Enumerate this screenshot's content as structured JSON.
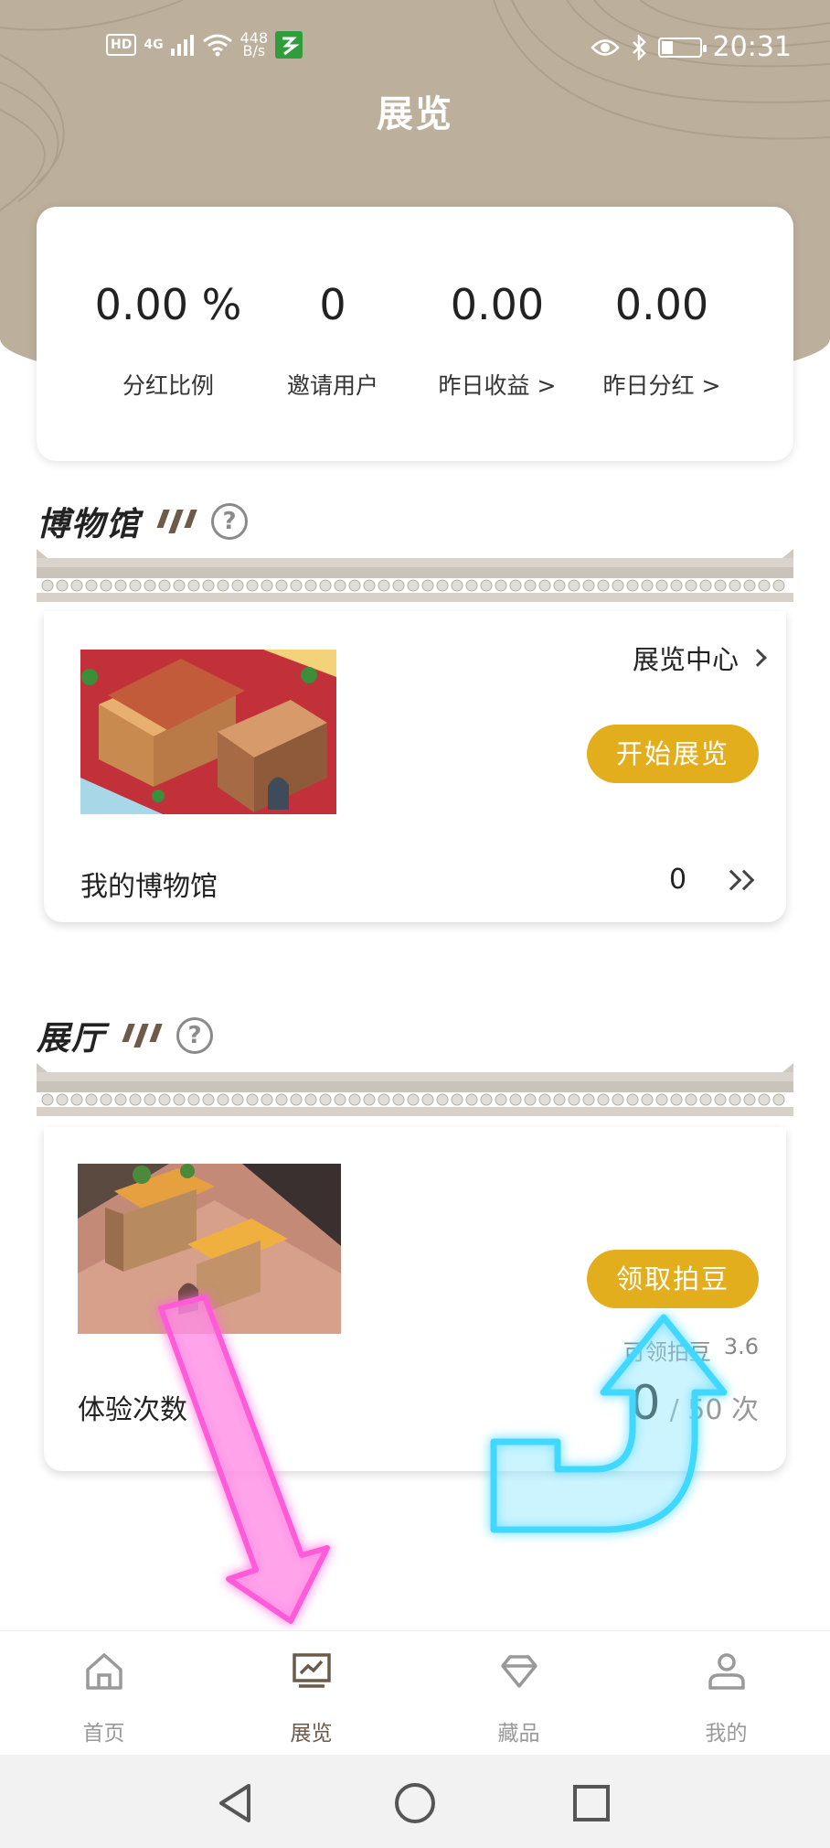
{
  "status_bar": {
    "left_hd": "HD",
    "network": "4G",
    "speed_value": "448",
    "speed_unit": "B/s",
    "time": "20:31"
  },
  "page": {
    "title": "展览"
  },
  "stats": [
    {
      "value": "0.00 %",
      "label": "分红比例"
    },
    {
      "value": "0",
      "label": "邀请用户"
    },
    {
      "value": "0.00",
      "label": "昨日收益 >"
    },
    {
      "value": "0.00",
      "label": "昨日分红 >"
    }
  ],
  "museum": {
    "section_title": "博物馆",
    "link_label": "展览中心",
    "button_label": "开始展览",
    "row_label": "我的博物馆",
    "row_value": "0"
  },
  "hall": {
    "section_title": "展厅",
    "button_label": "领取拍豆",
    "claimable_label": "可领拍豆",
    "claimable_value": "3.6",
    "row_label": "体验次数",
    "count_current": "0",
    "count_total": "/ 50 次"
  },
  "bottom_nav": [
    {
      "label": "首页",
      "icon": "home-icon"
    },
    {
      "label": "展览",
      "icon": "exhibition-icon"
    },
    {
      "label": "藏品",
      "icon": "diamond-icon"
    },
    {
      "label": "我的",
      "icon": "user-icon"
    }
  ],
  "colors": {
    "header_bg": "#bcb09c",
    "accent_gold": "#e3ae1e",
    "nav_active": "#6b5a4a",
    "nav_inactive": "#999999"
  }
}
